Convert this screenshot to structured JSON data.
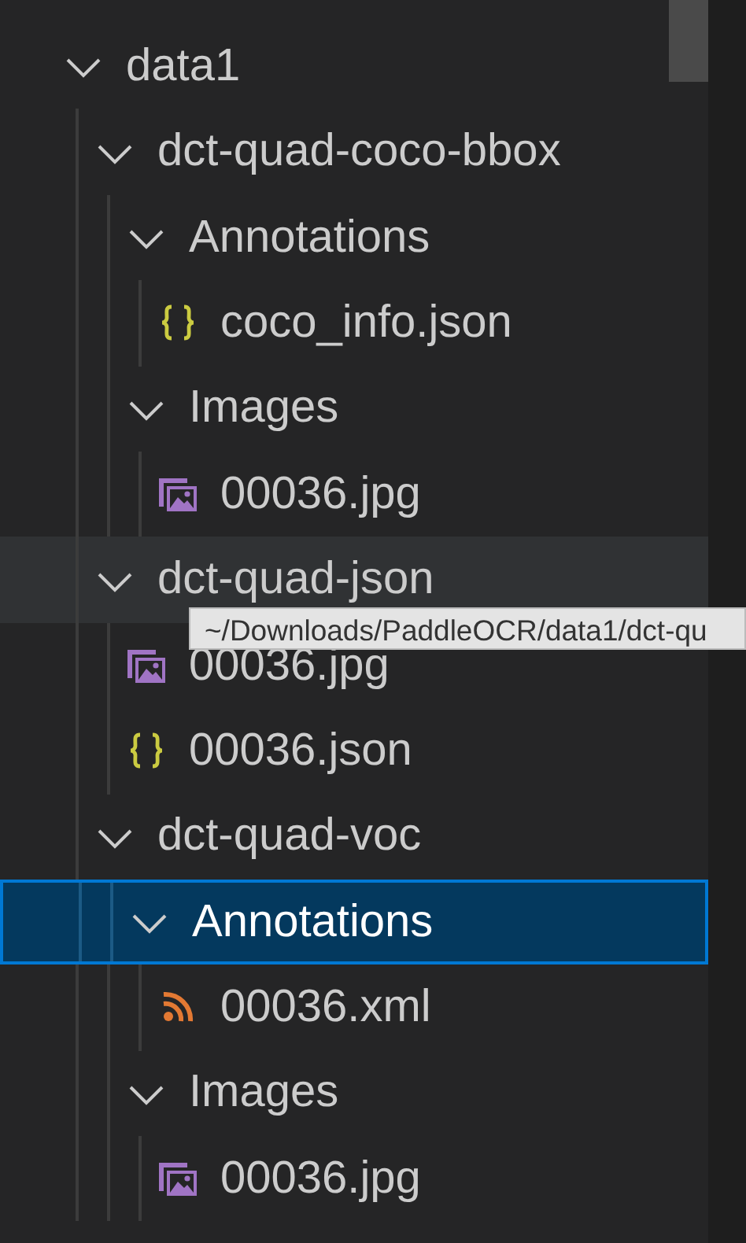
{
  "tree": [
    {
      "kind": "folder",
      "label": "data1",
      "expanded": true,
      "selected": false,
      "hovered": false,
      "children": [
        {
          "kind": "folder",
          "label": "dct-quad-coco-bbox",
          "expanded": true,
          "selected": false,
          "hovered": false,
          "children": [
            {
              "kind": "folder",
              "label": "Annotations",
              "expanded": true,
              "selected": false,
              "hovered": false,
              "children": [
                {
                  "kind": "json",
                  "label": "coco_info.json",
                  "selected": false,
                  "hovered": false
                }
              ]
            },
            {
              "kind": "folder",
              "label": "Images",
              "expanded": true,
              "selected": false,
              "hovered": false,
              "children": [
                {
                  "kind": "image",
                  "label": "00036.jpg",
                  "selected": false,
                  "hovered": false
                }
              ]
            }
          ]
        },
        {
          "kind": "folder",
          "label": "dct-quad-json",
          "expanded": true,
          "selected": false,
          "hovered": true,
          "children": [
            {
              "kind": "image",
              "label": "00036.jpg",
              "selected": false,
              "hovered": false
            },
            {
              "kind": "json",
              "label": "00036.json",
              "selected": false,
              "hovered": false
            }
          ]
        },
        {
          "kind": "folder",
          "label": "dct-quad-voc",
          "expanded": true,
          "selected": false,
          "hovered": false,
          "children": [
            {
              "kind": "folder",
              "label": "Annotations",
              "expanded": true,
              "selected": true,
              "hovered": false,
              "children": [
                {
                  "kind": "xml",
                  "label": "00036.xml",
                  "selected": false,
                  "hovered": false
                }
              ]
            },
            {
              "kind": "folder",
              "label": "Images",
              "expanded": true,
              "selected": false,
              "hovered": false,
              "children": [
                {
                  "kind": "image",
                  "label": "00036.jpg",
                  "selected": false,
                  "hovered": false
                }
              ]
            }
          ]
        }
      ]
    }
  ],
  "tooltip": {
    "text": "~/Downloads/PaddleOCR/data1/dct-qu"
  }
}
